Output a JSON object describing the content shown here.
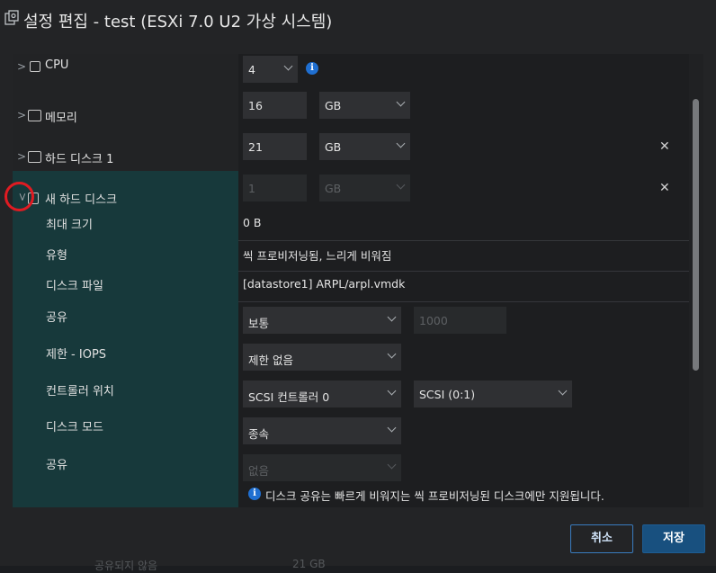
{
  "title": "설정 편집 - test (ESXi 7.0 U2 가상 시스템)",
  "rows": {
    "cpu": {
      "label": "CPU",
      "value": "4"
    },
    "memory": {
      "label": "메모리",
      "value": "16",
      "unit": "GB"
    },
    "hdd1": {
      "label": "하드 디스크 1",
      "value": "21",
      "unit": "GB"
    },
    "newdisk": {
      "label": "새 하드 디스크",
      "value": "1",
      "unit": "GB"
    }
  },
  "details": {
    "max_size_label": "최대 크기",
    "max_size_value": "0 B",
    "type_label": "유형",
    "type_value": "씩 프로비저닝됨, 느리게 비워짐",
    "disk_file_label": "디스크 파일",
    "disk_file_value": "[datastore1] ARPL/arpl.vmdk",
    "shares_label": "공유",
    "shares_value": "보통",
    "shares_num": "1000",
    "limit_label": "제한 - IOPS",
    "limit_value": "제한 없음",
    "controller_label": "컨트롤러 위치",
    "controller_value": "SCSI 컨트롤러 0",
    "controller_slot": "SCSI (0:1)",
    "disk_mode_label": "디스크 모드",
    "disk_mode_value": "종속",
    "sharing_label": "공유",
    "sharing_value": "없음",
    "sharing_info": "디스크 공유는 빠르게 비워지는 씩 프로비저닝된 디스크에만 지원됩니다."
  },
  "footer": {
    "cancel_label": "취소",
    "save_label": "저장",
    "ghost_left": "공유되지 않음",
    "ghost_right": "21 GB"
  },
  "colors": {
    "accent": "#1f6fd1",
    "teal_panel": "#17393b",
    "highlight": "#e01b22"
  }
}
